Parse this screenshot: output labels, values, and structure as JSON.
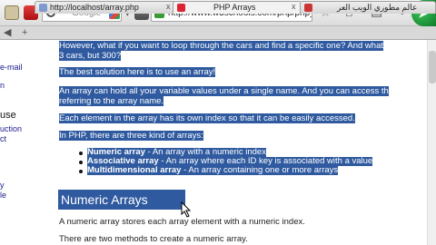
{
  "toolbar": {
    "search_placeholder": "Google",
    "url": "http://www.w3schools.com/php/php_arra",
    "nav_back": "◀",
    "nav_dropdown": "▾",
    "go_symbol": "➤"
  },
  "tabs": [
    {
      "label": "http://localhost/array.php"
    },
    {
      "label": "PHP Arrays"
    },
    {
      "label": "عالم مطوري الويب العر"
    }
  ],
  "tab_nav": {
    "left": "◀",
    "add": "+"
  },
  "sidebar": {
    "items": [
      "e-mail",
      "n",
      "use",
      "uction",
      "ct",
      "y",
      "le"
    ]
  },
  "content": {
    "para_top": "However, what if you want to loop through the cars and find a specific one? And what",
    "para_top2": "3 cars, but 300?",
    "solution": "The best solution here is to use an array!",
    "array_hold": "An array can hold all your variable values under a single name. And you can access th",
    "array_hold2": "referring to the array name.",
    "each_element": "Each element in the array has its own index so that it can be easily accessed.",
    "three_kinds": "In PHP, there are three kind of arrays:",
    "list": [
      {
        "term": "Numeric array",
        "desc": " - An array with a numeric index"
      },
      {
        "term": "Associative array",
        "desc": " - An array where each ID key is associated with a value"
      },
      {
        "term": "Multidimensional array",
        "desc": " - An array containing one or more arrays"
      }
    ],
    "heading": "Numeric Arrays",
    "numeric_desc": "A numeric array stores each array element with a numeric index.",
    "two_methods": "There are two methods to create a numeric array."
  }
}
